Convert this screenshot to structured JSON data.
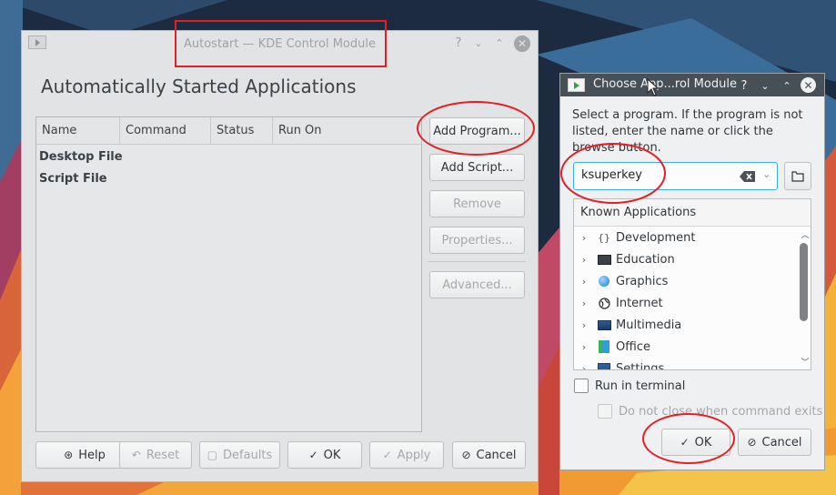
{
  "main_window": {
    "title": "Autostart — KDE Control Module",
    "heading": "Automatically Started Applications",
    "columns": [
      "Name",
      "Command",
      "Status",
      "Run On"
    ],
    "rows": [
      "Desktop File",
      "Script File"
    ],
    "buttons": {
      "add_program": "Add Program...",
      "add_script": "Add Script...",
      "remove": "Remove",
      "properties": "Properties...",
      "advanced": "Advanced..."
    },
    "footer": {
      "help": "Help",
      "reset": "Reset",
      "defaults": "Defaults",
      "ok": "OK",
      "apply": "Apply",
      "cancel": "Cancel"
    }
  },
  "dialog": {
    "title": "Choose App...rol Module",
    "instructions": "Select a program. If the program is not listed, enter the name or click the browse button.",
    "input_value": "ksuperkey",
    "tree_header": "Known Applications",
    "categories": [
      {
        "label": "Development",
        "icon": "braces-icon"
      },
      {
        "label": "Education",
        "icon": "monitor-icon"
      },
      {
        "label": "Graphics",
        "icon": "sphere-icon"
      },
      {
        "label": "Internet",
        "icon": "globe-icon"
      },
      {
        "label": "Multimedia",
        "icon": "media-icon"
      },
      {
        "label": "Office",
        "icon": "office-icon"
      },
      {
        "label": "Settings",
        "icon": "settings-icon"
      }
    ],
    "run_in_terminal": "Run in terminal",
    "do_not_close": "Do not close when command exits",
    "ok": "OK",
    "cancel": "Cancel"
  },
  "colors": {
    "annotation": "#e31e24",
    "focus": "#3daee9",
    "titlebar_active": "#475057"
  }
}
